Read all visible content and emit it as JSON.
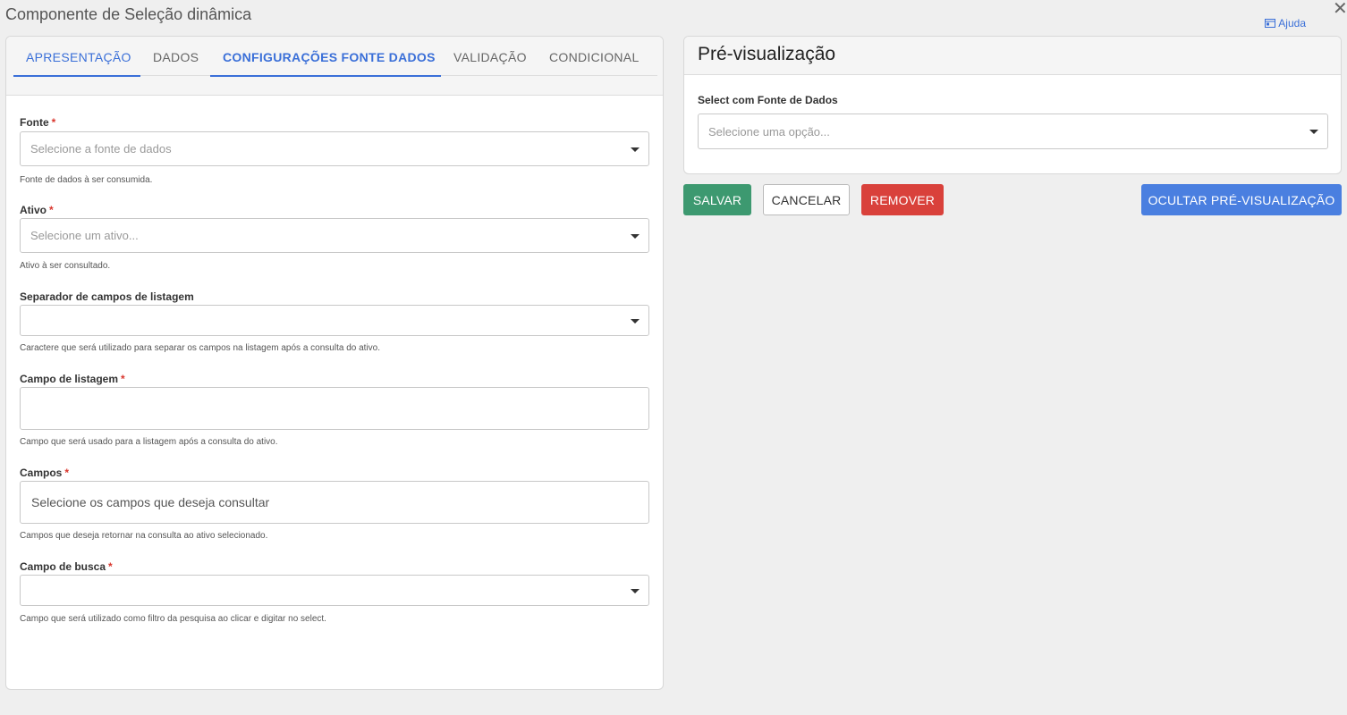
{
  "dialog": {
    "title": "Componente de Seleção dinâmica",
    "help_label": "Ajuda"
  },
  "tabs": [
    {
      "label": "APRESENTAÇÃO"
    },
    {
      "label": "DADOS"
    },
    {
      "label": "CONFIGURAÇÕES FONTE DADOS"
    },
    {
      "label": "VALIDAÇÃO"
    },
    {
      "label": "CONDICIONAL"
    }
  ],
  "form": {
    "fonte": {
      "label": "Fonte",
      "required": "*",
      "placeholder": "Selecione a fonte de dados",
      "help": "Fonte de dados à ser consumida."
    },
    "ativo": {
      "label": "Ativo",
      "required": "*",
      "placeholder": "Selecione um ativo...",
      "help": "Ativo à ser consultado."
    },
    "separador": {
      "label": "Separador de campos de listagem",
      "value": "",
      "help": "Caractere que será utilizado para separar os campos na listagem após a consulta do ativo."
    },
    "campo_listagem": {
      "label": "Campo de listagem",
      "required": "*",
      "value": "",
      "help": "Campo que será usado para a listagem após a consulta do ativo."
    },
    "campos": {
      "label": "Campos",
      "required": "*",
      "placeholder": "Selecione os campos que deseja consultar",
      "help": "Campos que deseja retornar na consulta ao ativo selecionado."
    },
    "campo_busca": {
      "label": "Campo de busca",
      "required": "*",
      "value": "",
      "help": "Campo que será utilizado como filtro da pesquisa ao clicar e digitar no select."
    }
  },
  "preview": {
    "title": "Pré-visualização",
    "select_label": "Select com Fonte de Dados",
    "select_placeholder": "Selecione uma opção..."
  },
  "buttons": {
    "save": "SALVAR",
    "cancel": "CANCELAR",
    "remove": "REMOVER",
    "hide_preview": "OCULTAR PRÉ-VISUALIZAÇÃO"
  },
  "colors": {
    "accent": "#3a6fd8",
    "save": "#3d9970",
    "remove": "#d9413b",
    "hide_preview": "#4a7fe0",
    "required": "#d9362d"
  },
  "icons": {
    "close": "close-icon",
    "help": "help-window-icon",
    "dropdown": "caret-down-icon"
  }
}
